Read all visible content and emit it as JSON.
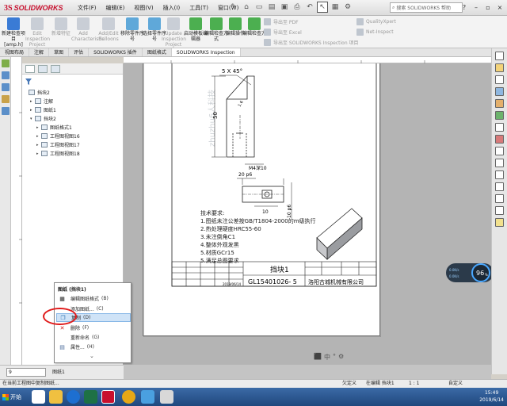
{
  "app": {
    "logo_ds": "3S",
    "logo_name": "SOLIDWORKS",
    "menus": [
      "文件(F)",
      "编辑(E)",
      "视图(V)",
      "插入(I)",
      "工具(T)",
      "窗口(W)"
    ],
    "search_placeholder": "搜索 SOLIDWORKS 帮助"
  },
  "ribbon": {
    "buttons": [
      {
        "label": "新建检查项目 [amp.h]",
        "enabled": true
      },
      {
        "label": "Edit Inspection Project",
        "enabled": false
      },
      {
        "label": "新增特征",
        "enabled": false
      },
      {
        "label": "Add Characteristic",
        "enabled": false
      },
      {
        "label": "Add/Edit Balloons",
        "enabled": false
      },
      {
        "label": "移除零件序号",
        "enabled": true
      },
      {
        "label": "选择零件序号",
        "enabled": true
      },
      {
        "label": "Update Inspection Project",
        "enabled": false
      },
      {
        "label": "启动模板编辑器",
        "enabled": true
      },
      {
        "label": "编辑检查方式",
        "enabled": true
      },
      {
        "label": "编辑操作",
        "enabled": true
      },
      {
        "label": "编辑检查方",
        "enabled": true
      }
    ],
    "exports": [
      "导出至 PDF",
      "导出至 Excel",
      "导出至 SOLIDWORKS Inspection 项目"
    ],
    "addins": [
      "QualityXpert",
      "Net-Inspect"
    ]
  },
  "tabs": [
    "视图布局",
    "注解",
    "草图",
    "评估",
    "SOLIDWORKS 插件",
    "图纸格式",
    "SOLIDWORKS Inspection"
  ],
  "active_tab": 6,
  "tree": {
    "items": [
      {
        "label": "挡块2",
        "expander": "",
        "level": 0
      },
      {
        "label": "注解",
        "expander": "▸",
        "level": 1
      },
      {
        "label": "图纸1",
        "expander": "▸",
        "level": 1
      },
      {
        "label": "挡块2",
        "expander": "▾",
        "level": 1
      },
      {
        "label": "图纸格式1",
        "expander": "▸",
        "level": 2
      },
      {
        "label": "工程图视图16",
        "expander": "▸",
        "level": 2
      },
      {
        "label": "工程图视图17",
        "expander": "▸",
        "level": 2
      },
      {
        "label": "工程图视图18",
        "expander": "▸",
        "level": 2
      }
    ]
  },
  "drawing": {
    "chamfer": "5 X 45°",
    "dim_height": "50",
    "dim_width": "M4深10",
    "dim_left": "20 p6",
    "dim_hole": "10",
    "dim_right": "10 p6",
    "roughness": "1.6",
    "notes_title": "技术要求:",
    "notes": [
      "1.图纸未注公差按GB/T1804-2000的m级执行",
      "2.热处理硬度HRC55-60",
      "3.未注倒角C1",
      "4.整体外观发黑",
      "5.材质GCr15",
      "5.满足总图要求"
    ],
    "title_part": "挡块1",
    "drawing_no": "GL15401026- 5",
    "company": "洛阳古城机械有限公司",
    "date": "2019/06/14",
    "watermark": "zhuzhu6人科技"
  },
  "context_menu": {
    "title": "图纸 (挡块1)",
    "items": [
      {
        "label": "编辑图纸格式",
        "key": "(B)",
        "icon": "edit-sheet-format-icon",
        "glyph": "▦",
        "highlight": false
      },
      {
        "label": "添加图纸...",
        "key": "(C)",
        "icon": "add-sheet-icon",
        "glyph": "",
        "highlight": false
      },
      {
        "label": "复制",
        "key": "(D)",
        "icon": "copy-icon",
        "glyph": "❐",
        "highlight": true
      },
      {
        "label": "删除",
        "key": "(F)",
        "icon": "delete-icon",
        "glyph": "✕",
        "highlight": false
      },
      {
        "label": "重新命名",
        "key": "(G)",
        "icon": "rename-icon",
        "glyph": "",
        "highlight": false
      },
      {
        "label": "属性...",
        "key": "(H)",
        "icon": "properties-icon",
        "glyph": "▤",
        "highlight": false
      }
    ]
  },
  "gauge": {
    "value": "96",
    "unit": "%",
    "up": "0.0K/s",
    "down": "0.0K/s"
  },
  "status": {
    "message": "在当前工程图中复制图纸...",
    "fields": [
      "欠定义",
      "在编辑 挡块1",
      "1 : 1",
      "自定义"
    ]
  },
  "sheet_tab": "图纸1",
  "combo_value": "9",
  "taskbar": {
    "start_label": "开始",
    "time": "15:49",
    "date": "2019/6/14"
  },
  "colors": {
    "brand": "#c8102e",
    "highlight": "#cfe3f7",
    "annotation": "#e01a1a",
    "taskbar": "#2b5896"
  }
}
